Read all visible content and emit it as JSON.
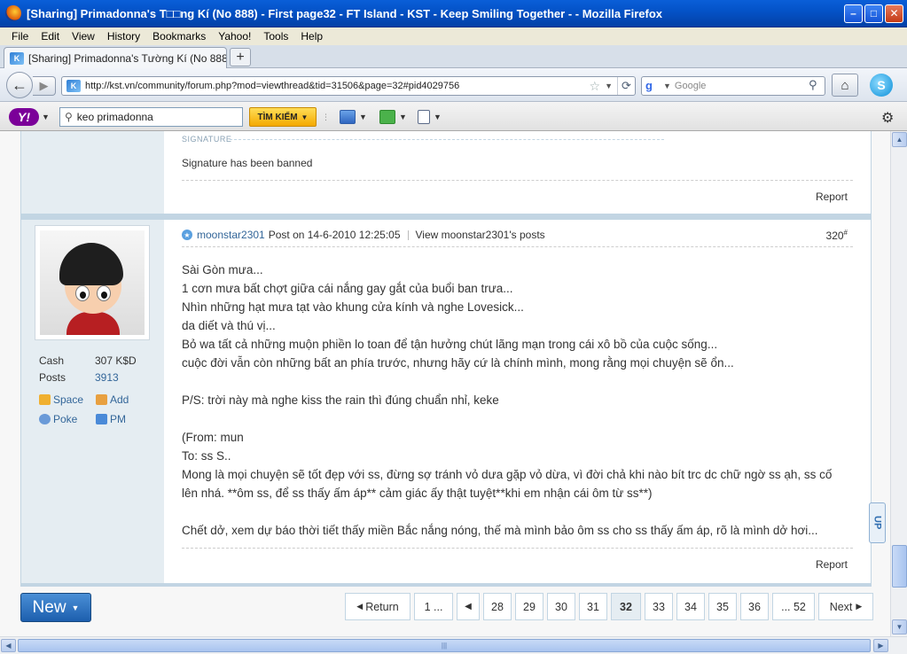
{
  "window": {
    "title": "[Sharing] Primadonna's T□□ng Kí (No 888) - First page32 - FT Island - KST - Keep Smiling Together - - Mozilla Firefox"
  },
  "menu": [
    "File",
    "Edit",
    "View",
    "History",
    "Bookmarks",
    "Yahoo!",
    "Tools",
    "Help"
  ],
  "tab": {
    "label": "[Sharing] Primadonna's Tường Kí (No 888) - ...",
    "newtab": "+"
  },
  "nav": {
    "url": "http://kst.vn/community/forum.php?mod=viewthread&tid=31506&page=32#pid4029756",
    "search_placeholder": "Google"
  },
  "yahoo": {
    "search_value": "keo primadonna",
    "search_button": "TÌM KIẾM"
  },
  "prev_post": {
    "signature_label": "SIGNATURE",
    "signature_text": "Signature has been banned",
    "report": "Report"
  },
  "post": {
    "author": "moonstar2301",
    "post_on": "Post on 14-6-2010 12:25:05",
    "view_posts": "View moonstar2301's posts",
    "floor": "320",
    "floor_mark": "#",
    "user": {
      "cash_label": "Cash",
      "cash_value": "307 K$D",
      "posts_label": "Posts",
      "posts_value": "3913",
      "space": "Space",
      "add": "Add",
      "poke": "Poke",
      "pm": "PM"
    },
    "lines": [
      "Sài Gòn mưa...",
      "1 cơn mưa bất chợt giữa cái nắng gay gắt của buổi ban trưa...",
      "Nhìn những hạt mưa tạt vào khung cửa kính và nghe Lovesick...",
      "da diết và thú vị...",
      "Bỏ wa tất cả những muộn phiền lo toan để tận hưởng chút lãng mạn trong cái xô bồ của cuộc sống...",
      "cuộc đời vẫn còn những bất an phía trước, nhưng hãy cứ là chính mình, mong rằng mọi chuyện sẽ ổn...",
      "",
      "P/S: trời này mà nghe kiss the rain thì đúng chuẩn nhỉ, keke",
      "",
      "(From: mun",
      "To: ss S..",
      "Mong là mọi chuyện sẽ tốt đẹp với ss, đừng sợ tránh vỏ dưa gặp vỏ dừa, vì đời chả khi nào bít trc dc chữ ngờ ss ạh, ss cố",
      "lên nhá. **ôm ss, để ss thấy ấm áp** cảm giác ấy thật tuyệt**khi em nhận cái ôm từ ss**)",
      "",
      "Chết dở, xem dự báo thời tiết thấy miền Bắc nắng nóng, thế mà mình bảo ôm ss cho ss thấy ấm áp, rõ là mình dở hơi..."
    ],
    "report": "Report"
  },
  "side": {
    "up": "UP"
  },
  "bottom": {
    "new_button": "New",
    "pages": [
      "Return",
      "1 ...",
      "",
      "28",
      "29",
      "30",
      "31",
      "32",
      "33",
      "34",
      "35",
      "36",
      "... 52",
      "Next"
    ],
    "current_page": "32"
  }
}
